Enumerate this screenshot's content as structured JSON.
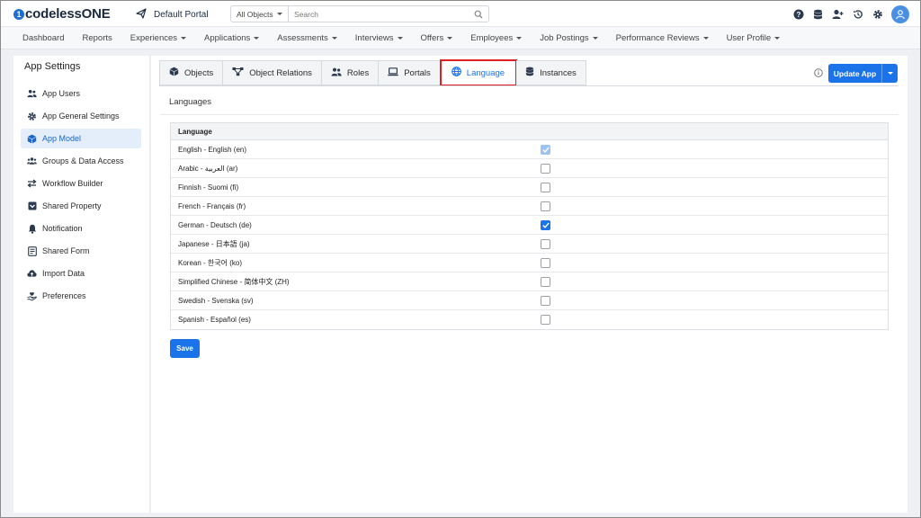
{
  "brand": {
    "logo_mark": "1",
    "name": "codelessONE"
  },
  "portal": {
    "icon": "paper-plane-icon",
    "name": "Default Portal"
  },
  "search": {
    "scope": "All Objects",
    "placeholder": "Search"
  },
  "topbar_icons": [
    "help-icon",
    "database-icon",
    "add-user-icon",
    "history-icon",
    "gear-icon",
    "user-avatar-icon"
  ],
  "nav": [
    {
      "label": "Dashboard",
      "dropdown": false
    },
    {
      "label": "Reports",
      "dropdown": false
    },
    {
      "label": "Experiences",
      "dropdown": true
    },
    {
      "label": "Applications",
      "dropdown": true
    },
    {
      "label": "Assessments",
      "dropdown": true
    },
    {
      "label": "Interviews",
      "dropdown": true
    },
    {
      "label": "Offers",
      "dropdown": true
    },
    {
      "label": "Employees",
      "dropdown": true
    },
    {
      "label": "Job Postings",
      "dropdown": true
    },
    {
      "label": "Performance Reviews",
      "dropdown": true
    },
    {
      "label": "User Profile",
      "dropdown": true
    }
  ],
  "sidebar": {
    "title": "App Settings",
    "items": [
      {
        "label": "App Users",
        "icon": "users-icon",
        "active": false
      },
      {
        "label": "App General Settings",
        "icon": "gear-icon",
        "active": false
      },
      {
        "label": "App Model",
        "icon": "cube-icon",
        "active": true
      },
      {
        "label": "Groups & Data Access",
        "icon": "group-icon",
        "active": false
      },
      {
        "label": "Workflow Builder",
        "icon": "arrows-exchange-icon",
        "active": false
      },
      {
        "label": "Shared Property",
        "icon": "checkbox-square-icon",
        "active": false
      },
      {
        "label": "Notification",
        "icon": "bell-icon",
        "active": false
      },
      {
        "label": "Shared Form",
        "icon": "form-icon",
        "active": false
      },
      {
        "label": "Import Data",
        "icon": "cloud-upload-icon",
        "active": false
      },
      {
        "label": "Preferences",
        "icon": "hand-heart-icon",
        "active": false
      }
    ]
  },
  "tabs": [
    {
      "label": "Objects",
      "icon": "cube-icon",
      "active": false
    },
    {
      "label": "Object Relations",
      "icon": "relations-icon",
      "active": false
    },
    {
      "label": "Roles",
      "icon": "users-icon",
      "active": false
    },
    {
      "label": "Portals",
      "icon": "laptop-icon",
      "active": false
    },
    {
      "label": "Language",
      "icon": "globe-icon",
      "active": true
    },
    {
      "label": "Instances",
      "icon": "database-icon",
      "active": false
    }
  ],
  "actions": {
    "update_app": "Update App",
    "info_icon": "info-icon"
  },
  "languages_section": {
    "title": "Languages",
    "column_header": "Language",
    "rows": [
      {
        "label": "English - English (en)",
        "checked": true,
        "disabled": true
      },
      {
        "label": "Arabic - العربية (ar)",
        "checked": false,
        "disabled": false
      },
      {
        "label": "Finnish - Suomi (fi)",
        "checked": false,
        "disabled": false
      },
      {
        "label": "French - Français (fr)",
        "checked": false,
        "disabled": false
      },
      {
        "label": "German - Deutsch (de)",
        "checked": true,
        "disabled": false
      },
      {
        "label": "Japanese - 日本語 (ja)",
        "checked": false,
        "disabled": false
      },
      {
        "label": "Korean - 한국어 (ko)",
        "checked": false,
        "disabled": false
      },
      {
        "label": "Simplified Chinese - 简体中文 (ZH)",
        "checked": false,
        "disabled": false
      },
      {
        "label": "Swedish - Svenska (sv)",
        "checked": false,
        "disabled": false
      },
      {
        "label": "Spanish - Español (es)",
        "checked": false,
        "disabled": false
      }
    ]
  },
  "save_label": "Save",
  "colors": {
    "accent": "#1a73e8",
    "brand_dark": "#1b2a3e",
    "highlight_outline": "#e02020",
    "active_bg": "#e4eefb"
  }
}
